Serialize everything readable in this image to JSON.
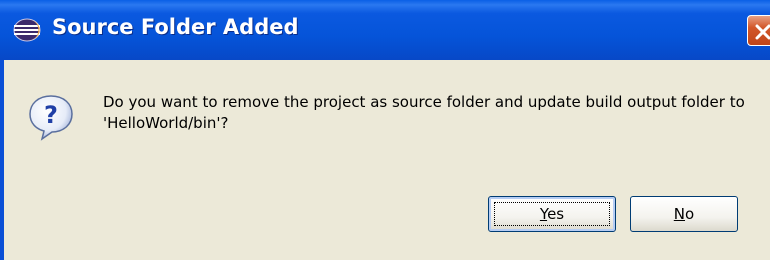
{
  "window": {
    "title": "Source Folder Added",
    "app_icon": "eclipse-icon",
    "close_icon": "close-icon"
  },
  "message": {
    "icon": "question-icon",
    "text": "Do you want to remove the project as source folder and update build output folder to 'HelloWorld/bin'?"
  },
  "buttons": {
    "yes": {
      "mnemonic": "Y",
      "rest": "es"
    },
    "no": {
      "mnemonic": "N",
      "rest": "o"
    }
  },
  "colors": {
    "titlebar": "#0554d9",
    "close": "#d2572a",
    "dialog_bg": "#ece9d8",
    "question_icon": "#1f3fa6"
  }
}
